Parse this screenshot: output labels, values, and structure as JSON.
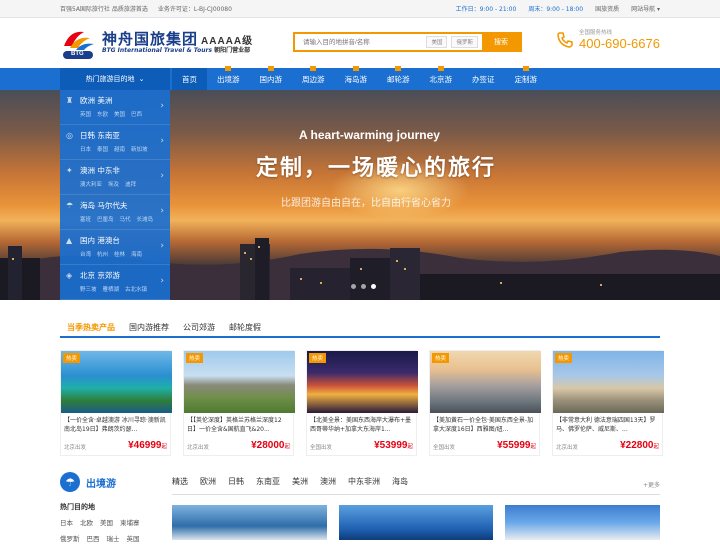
{
  "topbar": {
    "left": [
      "百强5A国际旅行社 品质旅游首选",
      "业务许可证：L-BJ-CJ00080"
    ],
    "right": [
      "工作日：9:00 - 21:00",
      "周末：9:00 - 18:00",
      "国旅资质",
      "网站导航 ▾"
    ]
  },
  "header": {
    "logo_cn": "神舟国旅集团",
    "logo_grade": "AAAAA级",
    "logo_en": "BTG International Travel & Tours",
    "logo_branch": "朝阳门营业部",
    "logo_mark_label": "BTG",
    "search_placeholder": "请输入目的地拼音/名称",
    "search_chips": [
      "美国",
      "俄罗斯"
    ],
    "search_button": "搜索",
    "hotline_label": "全国服务热线",
    "hotline_number": "400-690-6676"
  },
  "nav": {
    "category_label": "热门旅游目的地",
    "items": [
      {
        "label": "首页",
        "active": true,
        "dot": false
      },
      {
        "label": "出境游",
        "active": false,
        "dot": true
      },
      {
        "label": "国内游",
        "active": false,
        "dot": true
      },
      {
        "label": "周边游",
        "active": false,
        "dot": true
      },
      {
        "label": "海岛游",
        "active": false,
        "dot": true
      },
      {
        "label": "邮轮游",
        "active": false,
        "dot": true
      },
      {
        "label": "北京游",
        "active": false,
        "dot": true
      },
      {
        "label": "办签证",
        "active": false,
        "dot": false
      },
      {
        "label": "定制游",
        "active": false,
        "dot": true
      }
    ]
  },
  "sidebar": [
    {
      "title": "欧洲  美洲",
      "subs": [
        "英国",
        "东欧",
        "美国",
        "巴西"
      ]
    },
    {
      "title": "日韩  东南亚",
      "subs": [
        "日本",
        "泰国",
        "越南",
        "新加坡"
      ]
    },
    {
      "title": "澳洲  中东非",
      "subs": [
        "澳大利亚",
        "埃及",
        "迪拜"
      ]
    },
    {
      "title": "海岛  马尔代夫",
      "subs": [
        "塞班",
        "巴厘岛",
        "马代",
        "长滩岛"
      ]
    },
    {
      "title": "国内  港澳台",
      "subs": [
        "台湾",
        "杭州",
        "桂林",
        "海南"
      ]
    },
    {
      "title": "北京  京郊游",
      "subs": [
        "野三坡",
        "雁栖湖",
        "古北水镇"
      ]
    }
  ],
  "hero": {
    "en": "A heart-warming journey",
    "cn": "定制，一场暖心的旅行",
    "sub": "比跟团游自由自在，比自由行省心省力",
    "dots": 3,
    "active_dot": 2
  },
  "hot": {
    "tabs": [
      "当季热卖产品",
      "国内游推荐",
      "公司郊游",
      "邮轮度假"
    ],
    "active_tab": 0,
    "cards": [
      {
        "tag": "热卖",
        "title": "【一价全含·卓越澳游 冰川寻踪·澳新凯 南北岛19日】弗朗茨约瑟...",
        "from": "北京出发",
        "price": "46999",
        "unit": "起",
        "scene": "reef"
      },
      {
        "tag": "热卖",
        "title": "【【英伦深度】英格兰苏格兰深度12日】一价全含&国航直飞&20...",
        "from": "北京出发",
        "price": "28000",
        "unit": "起",
        "scene": "castle"
      },
      {
        "tag": "热卖",
        "title": "【北美全景：美国东西海岸大瀑布+墨西哥蒂华纳+加拿大东海岸1...",
        "from": "全国出发",
        "price": "53999",
        "unit": "起",
        "scene": "vegas"
      },
      {
        "tag": "热卖",
        "title": "【美加黄石一价全包·美国东西全景-加拿大深度16日】西雅图/纽...",
        "from": "全国出发",
        "price": "55999",
        "unit": "起",
        "scene": "nyc"
      },
      {
        "tag": "热卖",
        "title": "【非常意大利 德法意瑞四国13天】罗马、佛罗伦萨、威尼斯、...",
        "from": "北京出发",
        "price": "22800",
        "unit": "起",
        "scene": "paris"
      }
    ]
  },
  "outbound": {
    "title": "出境游",
    "tabs": [
      "精选",
      "欧洲",
      "日韩",
      "东南亚",
      "美洲",
      "澳洲",
      "中东非洲",
      "海岛"
    ],
    "active_tab": 0,
    "more": "+更多",
    "hot_dest_title": "热门目的地",
    "hot_dest_rows": [
      [
        "日本",
        "北欧",
        "美国",
        "柬埔寨"
      ],
      [
        "俄罗斯",
        "巴西",
        "瑞士",
        "英国"
      ]
    ]
  },
  "colors": {
    "brand_blue": "#1a6fd0",
    "accent_orange": "#f39800",
    "price_red": "#e60012"
  }
}
